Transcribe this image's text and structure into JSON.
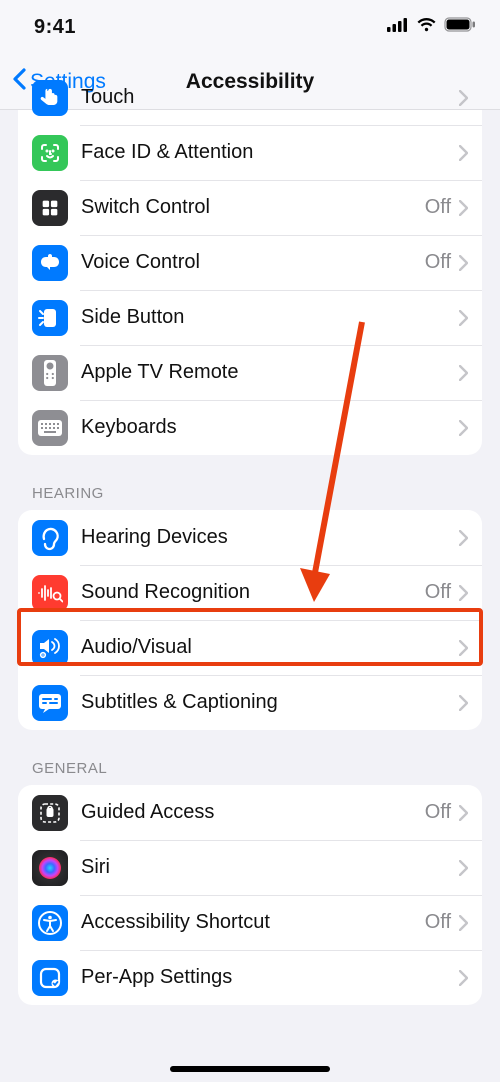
{
  "status": {
    "time": "9:41"
  },
  "nav": {
    "back_label": "Settings",
    "title": "Accessibility"
  },
  "value_off": "Off",
  "sections": {
    "first_rows": [
      {
        "label": "Touch",
        "value": ""
      },
      {
        "label": "Face ID & Attention",
        "value": ""
      },
      {
        "label": "Switch Control",
        "value": "Off"
      },
      {
        "label": "Voice Control",
        "value": "Off"
      },
      {
        "label": "Side Button",
        "value": ""
      },
      {
        "label": "Apple TV Remote",
        "value": ""
      },
      {
        "label": "Keyboards",
        "value": ""
      }
    ],
    "hearing": {
      "header": "HEARING",
      "rows": [
        {
          "label": "Hearing Devices",
          "value": ""
        },
        {
          "label": "Sound Recognition",
          "value": "Off"
        },
        {
          "label": "Audio/Visual",
          "value": ""
        },
        {
          "label": "Subtitles & Captioning",
          "value": ""
        }
      ]
    },
    "general": {
      "header": "GENERAL",
      "rows": [
        {
          "label": "Guided Access",
          "value": "Off"
        },
        {
          "label": "Siri",
          "value": ""
        },
        {
          "label": "Accessibility Shortcut",
          "value": "Off"
        },
        {
          "label": "Per-App Settings",
          "value": ""
        }
      ]
    }
  },
  "annotation": {
    "highlighted_row": "Audio/Visual",
    "arrow_points_to": "Audio/Visual"
  }
}
